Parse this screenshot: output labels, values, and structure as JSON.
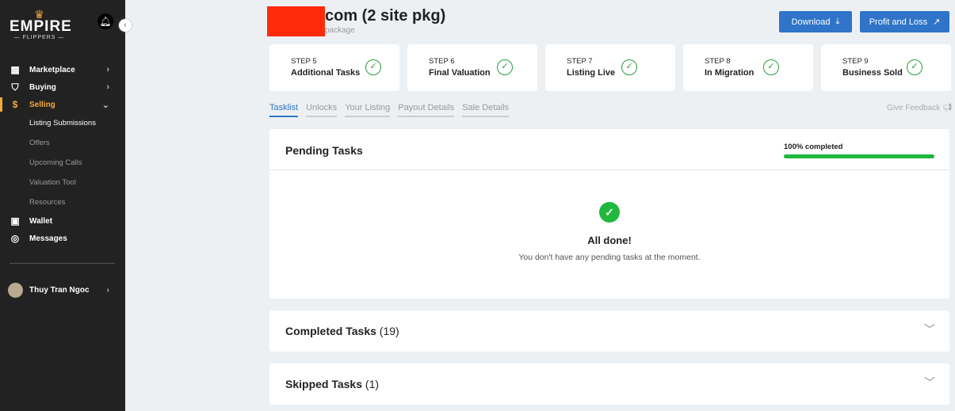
{
  "sidebar": {
    "logo": {
      "main": "EMPIRE",
      "sub": "— FLIPPERS —"
    },
    "items": [
      {
        "label": "Marketplace",
        "icon": "grid-icon"
      },
      {
        "label": "Buying",
        "icon": "bag-icon"
      },
      {
        "label": "Selling",
        "icon": "dollar-icon"
      }
    ],
    "sub_items": [
      "Listing Submissions",
      "Offers",
      "Upcoming Calls",
      "Valuation Tool",
      "Resources"
    ],
    "bottom_items": [
      {
        "label": "Wallet",
        "icon": "wallet-icon"
      },
      {
        "label": "Messages",
        "icon": "chat-icon"
      }
    ],
    "user": "Thuy Tran Ngoc"
  },
  "header": {
    "title": "com (2 site pkg)",
    "subtitle": "package",
    "download": "Download",
    "profit_loss": "Profit and Loss"
  },
  "steps": [
    {
      "n": "STEP 5",
      "l": "Additional Tasks"
    },
    {
      "n": "STEP 6",
      "l": "Final Valuation"
    },
    {
      "n": "STEP 7",
      "l": "Listing Live"
    },
    {
      "n": "STEP 8",
      "l": "In Migration"
    },
    {
      "n": "STEP 9",
      "l": "Business Sold"
    }
  ],
  "tabs": [
    "Tasklist",
    "Unlocks",
    "Your Listing",
    "Payout Details",
    "Sale Details"
  ],
  "feedback": "Give Feedback",
  "pending": {
    "title": "Pending Tasks",
    "progress_label": "100% completed",
    "progress": 100,
    "done_title": "All done!",
    "done_text": "You don't have any pending tasks at the moment."
  },
  "completed": {
    "title": "Completed Tasks",
    "count": "(19)"
  },
  "skipped": {
    "title": "Skipped Tasks",
    "count": "(1)"
  },
  "colors": {
    "accent": "#2f74c8",
    "selling": "#f2a93b",
    "success": "#1fb83d"
  }
}
